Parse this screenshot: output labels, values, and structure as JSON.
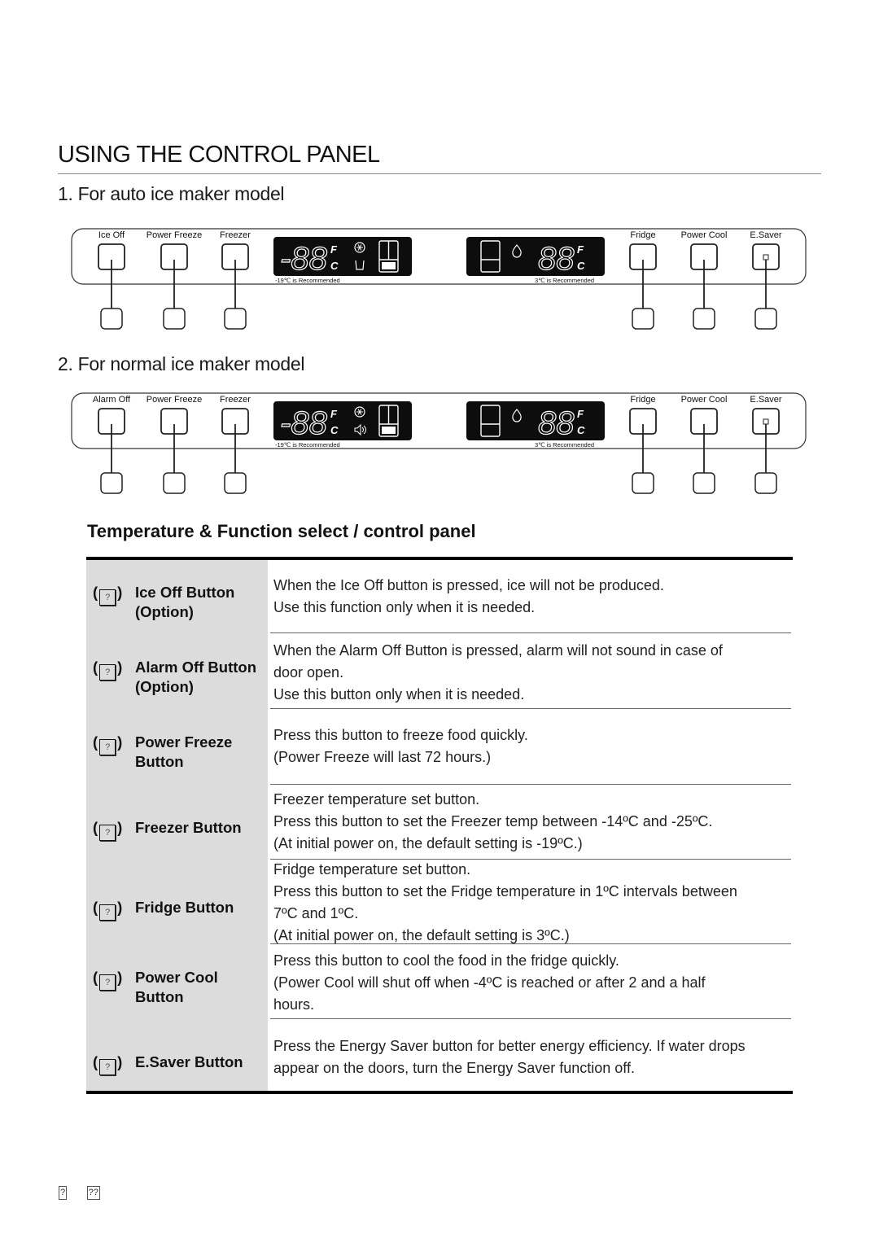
{
  "page": {
    "title": "USING THE CONTROL PANEL",
    "subtitle_1": "1. For auto ice maker model",
    "subtitle_2": "2. For normal ice maker model",
    "section_title": "Temperature & Function select / control panel"
  },
  "panels": [
    {
      "model": "auto ice maker",
      "left_buttons": [
        "Ice Off",
        "Power Freeze",
        "Freezer"
      ],
      "right_buttons": [
        "Fridge",
        "Power Cool",
        "E.Saver"
      ],
      "freezer_display": {
        "digits": "-88",
        "unit_top": "F",
        "unit_bottom": "C",
        "status_icons": [
          "snowflake-icon",
          "ice-off-icon"
        ],
        "recommended": "-19℃ is Recommended"
      },
      "fridge_display": {
        "digits": "88",
        "unit_top": "F",
        "unit_bottom": "C",
        "status_icons": [
          "water-drop-icon"
        ],
        "recommended": "3℃ is Recommended"
      }
    },
    {
      "model": "normal ice maker",
      "left_buttons": [
        "Alarm Off",
        "Power Freeze",
        "Freezer"
      ],
      "right_buttons": [
        "Fridge",
        "Power Cool",
        "E.Saver"
      ],
      "freezer_display": {
        "digits": "-88",
        "unit_top": "F",
        "unit_bottom": "C",
        "status_icons": [
          "snowflake-icon",
          "speaker-icon"
        ],
        "recommended": "-19℃ is Recommended"
      },
      "fridge_display": {
        "digits": "88",
        "unit_top": "F",
        "unit_bottom": "C",
        "status_icons": [
          "water-drop-icon"
        ],
        "recommended": "3℃ is Recommended"
      }
    }
  ],
  "table": {
    "rows": [
      {
        "label": [
          "Ice Off Button",
          "(Option)"
        ],
        "icon": "?",
        "description": [
          "When the Ice Off button is pressed, ice will not be produced.",
          "Use this function only when it is needed."
        ]
      },
      {
        "label": [
          "Alarm Off Button",
          "(Option)"
        ],
        "icon": "?",
        "description": [
          "When the Alarm Off Button is pressed, alarm will not sound in case of",
          "door open.",
          "Use this button only when it is needed."
        ]
      },
      {
        "label": [
          "Power Freeze",
          "Button"
        ],
        "icon": "?",
        "description": [
          "Press this button to freeze food quickly.",
          "(Power Freeze will last 72 hours.)"
        ]
      },
      {
        "label": [
          "Freezer Button"
        ],
        "icon": "?",
        "description": [
          "Freezer temperature set button.",
          "Press this button to set the Freezer temp between -14ºC and -25ºC.",
          "(At initial power on, the default setting is -19ºC.)"
        ]
      },
      {
        "label": [
          "Fridge Button"
        ],
        "icon": "?",
        "description": [
          "Fridge temperature set button.",
          "Press this button to set the Fridge temperature in 1ºC intervals between",
          "7ºC and 1ºC.",
          "(At initial power on, the default setting is 3ºC.)"
        ]
      },
      {
        "label": [
          "Power Cool",
          "Button"
        ],
        "icon": "?",
        "description": [
          "Press this button to cool the food in the fridge quickly.",
          "(Power Cool will shut off when -4ºC is reached or after 2 and a half",
          "hours."
        ]
      },
      {
        "label": [
          "E.Saver Button"
        ],
        "icon": "?",
        "description": [
          "Press the Energy Saver button for better energy efficiency. If water drops",
          "appear on the doors, turn the Energy Saver function off."
        ]
      }
    ]
  },
  "footer": {
    "glyph_1": "?",
    "glyph_2": "??"
  }
}
